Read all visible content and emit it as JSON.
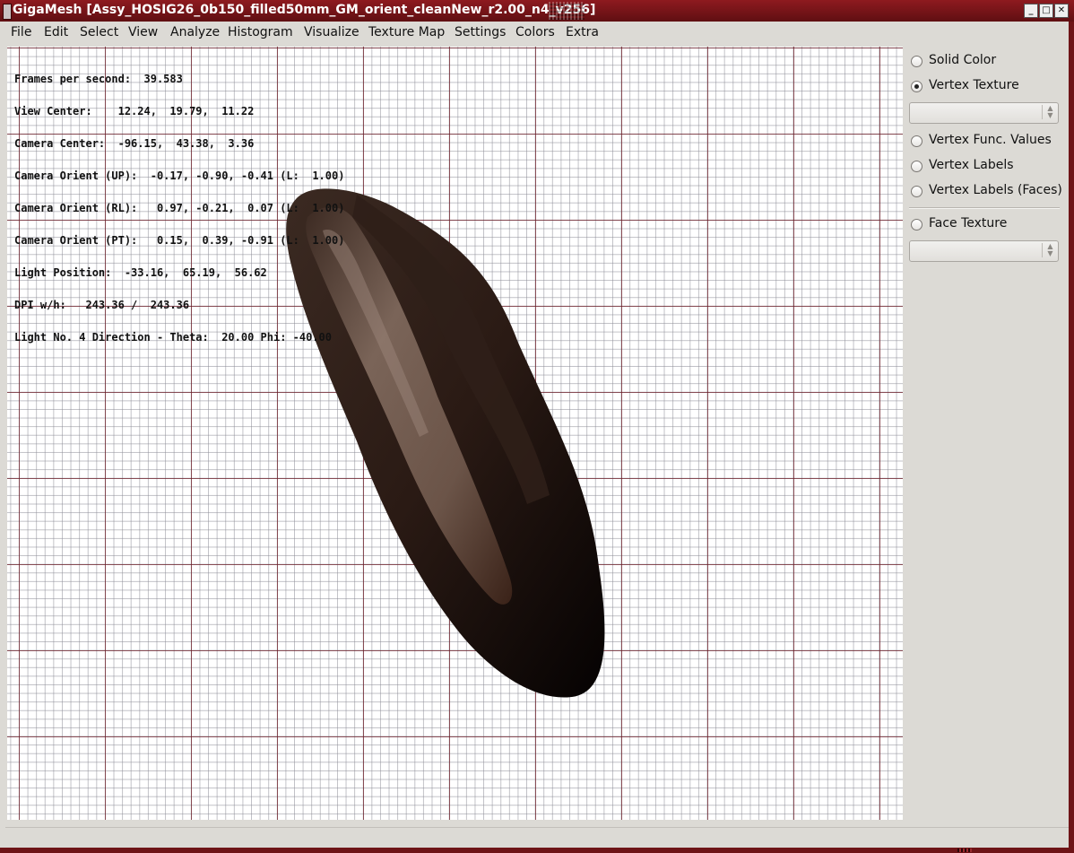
{
  "window": {
    "title": "GigaMesh [Assy_HOSIG26_0b150_filled50mm_GM_orient_cleanNew_r2.00_n4_v256]",
    "controls": {
      "minimize": "_",
      "maximize": "□",
      "close": "✕"
    }
  },
  "menu": [
    "File",
    "Edit",
    "Select",
    "View",
    "Analyze",
    "Histogram",
    "Visualize",
    "Texture Map",
    "Settings",
    "Colors",
    "Extra"
  ],
  "hud": {
    "fps": "Frames per second:  39.583",
    "view_center": "View Center:    12.24,  19.79,  11.22",
    "camera_center": "Camera Center:  -96.15,  43.38,  3.36",
    "orient_up": "Camera Orient (UP):  -0.17, -0.90, -0.41 (L:  1.00)",
    "orient_rl": "Camera Orient (RL):   0.97, -0.21,  0.07 (L:  1.00)",
    "orient_pt": "Camera Orient (PT):   0.15,  0.39, -0.91 (L:  1.00)",
    "light_position": "Light Position:  -33.16,  65.19,  56.62",
    "dpi": "DPI w/h:   243.36 /  243.36",
    "light_direction": "Light No. 4 Direction - Theta:  20.00 Phi: -40.00"
  },
  "panel": {
    "solid_color": "Solid Color",
    "vertex_texture": "Vertex Texture",
    "vertex_texture_select": "",
    "vertex_func_values": "Vertex Func. Values",
    "vertex_labels": "Vertex Labels",
    "vertex_labels_faces": "Vertex Labels (Faces)",
    "face_texture": "Face Texture",
    "face_texture_select": "",
    "selected": "vertex_texture"
  },
  "colors": {
    "window_frame": "#6e1417",
    "title_bar": "#8e1a1f",
    "panel_bg": "#dcdad5",
    "grid_major": "#6e1e28",
    "grid_minor": "#8c8c96",
    "mesh_dark": "#1a0d0a",
    "mesh_surface": "#8a7569"
  },
  "icons": {
    "app": "gigamesh-app-icon",
    "combo_arrow": "up-down-arrows-icon"
  }
}
